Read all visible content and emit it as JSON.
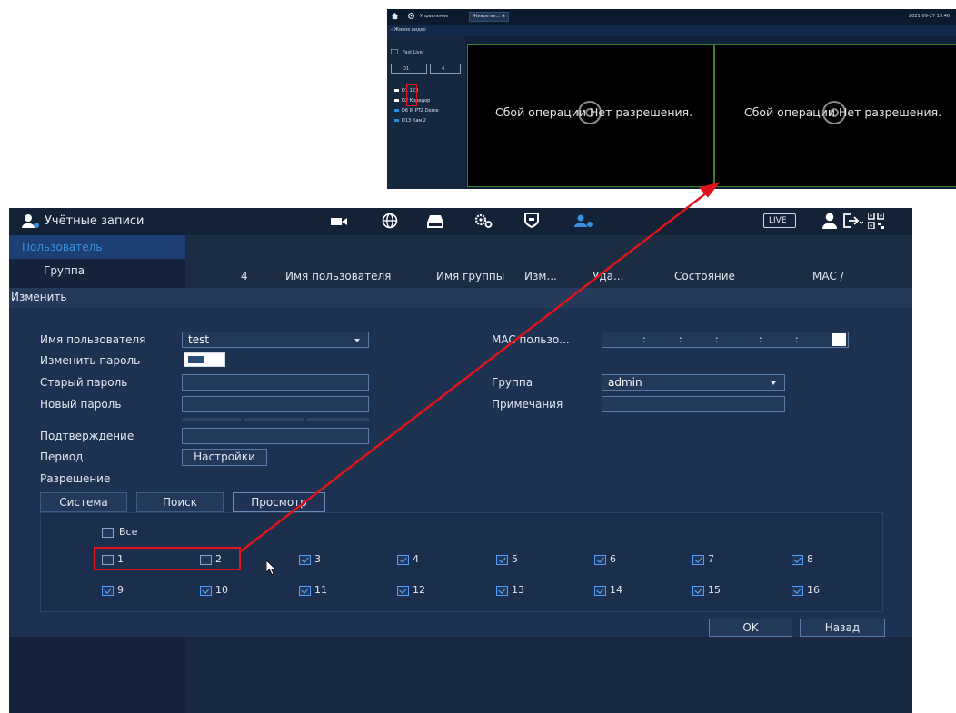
{
  "live_view": {
    "header": {
      "control_label": "Управление",
      "tab_label": "Живое ви... ✖",
      "datetime": "2021-09-27 15:46"
    },
    "subbar_label": "‹ Живое видео",
    "sidebar": {
      "fast_live_label": "Fast Live",
      "channel_select": "D1",
      "layout_select": "4",
      "devices": [
        {
          "label": "D1 123",
          "icon": "camera-icon-white"
        },
        {
          "label": "D2 Коридор",
          "icon": "camera-icon-white"
        },
        {
          "label": "D6 IP PTZ Dome",
          "icon": "camera-icon-blue"
        },
        {
          "label": "D13 Кам 2",
          "icon": "camera-icon-blue"
        }
      ]
    },
    "panes": [
      {
        "message": "Сбой операции Нет разрешения.",
        "icon": "camera-icon"
      },
      {
        "message": "Сбой операции Нет разрешения.",
        "icon": "camera-icon"
      }
    ]
  },
  "app": {
    "title": "Учётные записи",
    "nav_icons": [
      "camera-icon",
      "globe-icon",
      "storage-icon",
      "settings-icon",
      "shield-icon",
      "users-icon"
    ],
    "live_label": "LIVE",
    "right_icons": [
      "user-icon",
      "logout-icon",
      "qr-icon"
    ],
    "accent": "#3b8fe0"
  },
  "menu": {
    "items": [
      {
        "label": "Пользователь"
      },
      {
        "label": "Группа"
      }
    ]
  },
  "table": {
    "headers": [
      "4",
      "Имя пользователя",
      "Имя группы",
      "Изм...",
      "Уда...",
      "Состояние",
      "MAC /"
    ]
  },
  "dialog": {
    "title": "Изменить",
    "username_label": "Имя пользователя",
    "username_value": "test",
    "change_password_label": "Изменить пароль",
    "old_password_label": "Старый пароль",
    "new_password_label": "Новый пароль",
    "confirm_label": "Подтверждение",
    "period_label": "Период",
    "period_button": "Настройки",
    "mac_label": "MAC пользо...",
    "mac_separator": ":",
    "group_label": "Группа",
    "group_value": "admin",
    "notes_label": "Примечания",
    "permission_label": "Разрешение",
    "perm_tabs": [
      "Система",
      "Поиск",
      "Просмотр"
    ],
    "all_label": "Все",
    "channels": [
      {
        "label": "1",
        "checked": false
      },
      {
        "label": "2",
        "checked": false
      },
      {
        "label": "3",
        "checked": true
      },
      {
        "label": "4",
        "checked": true
      },
      {
        "label": "5",
        "checked": true
      },
      {
        "label": "6",
        "checked": true
      },
      {
        "label": "7",
        "checked": true
      },
      {
        "label": "8",
        "checked": true
      },
      {
        "label": "9",
        "checked": true
      },
      {
        "label": "10",
        "checked": true
      },
      {
        "label": "11",
        "checked": true
      },
      {
        "label": "12",
        "checked": true
      },
      {
        "label": "13",
        "checked": true
      },
      {
        "label": "14",
        "checked": true
      },
      {
        "label": "15",
        "checked": true
      },
      {
        "label": "16",
        "checked": true
      }
    ],
    "ok_label": "OK",
    "back_label": "Назад"
  },
  "annotation": {
    "color": "#e0141b"
  }
}
